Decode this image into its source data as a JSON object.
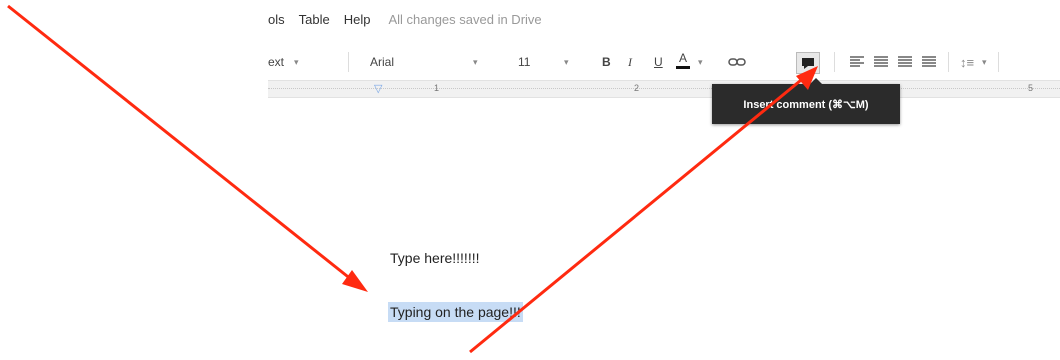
{
  "menubar": {
    "items": [
      "ols",
      "Table",
      "Help"
    ],
    "status": "All changes saved in Drive"
  },
  "toolbar": {
    "style_label": "ext",
    "font_name": "Arial",
    "font_size": "11",
    "bold": "B",
    "italic": "I",
    "underline": "U",
    "font_color": "A",
    "link_icon": "link-icon",
    "comment_icon": "insert-comment-icon"
  },
  "ruler": {
    "marks": [
      "1",
      "2",
      "5"
    ]
  },
  "tooltip": {
    "text": "Insert comment (⌘⌥M)"
  },
  "document": {
    "line1": "Type here!!!!!!!",
    "line2": "Typing on the page!!!"
  },
  "colors": {
    "arrow": "#ff2a10",
    "selection": "#c7dcf5",
    "tooltip_bg": "#2b2b2b"
  }
}
